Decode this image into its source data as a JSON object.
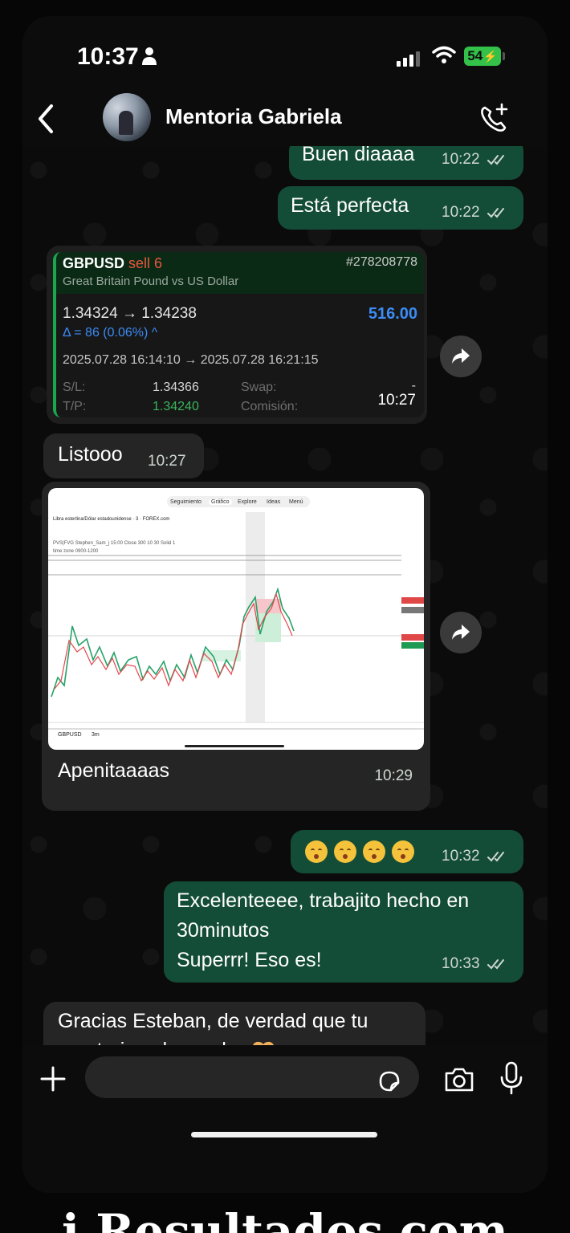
{
  "status_bar": {
    "time": "10:37",
    "battery": "54"
  },
  "header": {
    "contact_name": "Mentoria Gabriela"
  },
  "messages": {
    "m1": {
      "text": "Buen diaaaa",
      "time": "10:22"
    },
    "m2": {
      "text": "Está perfecta",
      "time": "10:22"
    },
    "trade_card": {
      "symbol": "GBPUSD",
      "direction": "sell 6",
      "ticket": "#278208778",
      "description": "Great Britain Pound vs US Dollar",
      "prices": "1.34324 → 1.34238",
      "profit": "516.00",
      "delta": "Δ = 86 (0.06%) ^",
      "dates": "2025.07.28 16:14:10 → 2025.07.28 16:21:15",
      "sl_label": "S/L:",
      "sl_value": "1.34366",
      "tp_label": "T/P:",
      "tp_value": "1.34240",
      "swap_label": "Swap:",
      "swap_value": "-",
      "commission_label": "Comisión:",
      "time": "10:27"
    },
    "m3": {
      "text": "Listooo",
      "time": "10:27"
    },
    "chart_image": {
      "tabs": [
        "Seguimiento",
        "Gráfico",
        "Explore",
        "Ideas",
        "Menú"
      ],
      "pair_title": "Libra esterlina/Dólar estadounidense · 3 · FOREX.com",
      "indicator": "PVS|FVG Stephen_Sam_j 15:00 Close 300 10 30 Solid 1",
      "timezone": "time zone 0900-1200",
      "symbol": "GBPUSD",
      "interval": "3m",
      "caption": "Apenitaaaas",
      "time": "10:29"
    },
    "m4": {
      "time": "10:32"
    },
    "m5": {
      "line1": "Excelenteeee, trabajito hecho en",
      "line2": "30minutos",
      "line3": "Superrr! Eso es!",
      "time": "10:33"
    },
    "m6": {
      "line1": "Gracias Esteban, de verdad que tu",
      "line2": "mentoria vale mucho"
    }
  },
  "bottom_caption": "i Resultados com meu Esquema!"
}
